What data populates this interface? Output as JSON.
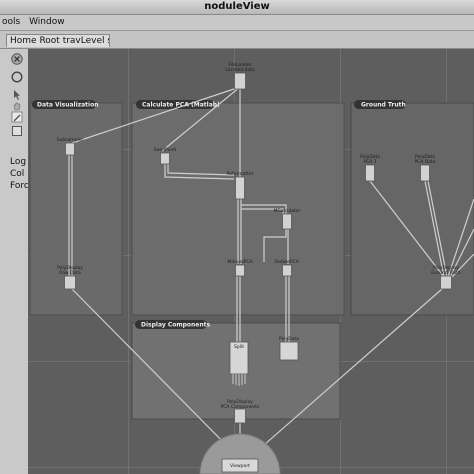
{
  "window": {
    "title": "noduleView"
  },
  "menubar": {
    "items": [
      "ools",
      "Window"
    ]
  },
  "breadcrumb": {
    "text": "Home Root travLevel shmStatus"
  },
  "left_panel": {
    "tools": [
      {
        "name": "close-tool",
        "icon": "x-circle-icon"
      },
      {
        "name": "circle-tool",
        "icon": "circle-icon"
      },
      {
        "name": "pointer-tool",
        "icon": "pointer-icon"
      },
      {
        "name": "hand-tool",
        "icon": "hand-icon"
      },
      {
        "name": "edit-tool",
        "icon": "pencil-icon"
      },
      {
        "name": "select-tool",
        "icon": "square-icon"
      }
    ],
    "labels": {
      "log": "Log",
      "col": "Col",
      "force": "Force"
    }
  },
  "canvas": {
    "groups": {
      "data_visualization": "Data Visualization",
      "calculate_pca": "Calculate PCA (Matlab)",
      "ground_truth": "Ground Truth",
      "display_components": "Display Components"
    },
    "nodes": {
      "top_loader": "FileLoader\nLocated data",
      "subsampler": "Subsampler",
      "seedpoint": "SeedPoint",
      "reformatter": "Reformatter",
      "setcomputer": "MCalculator",
      "manual_pca": "ManualPCA",
      "rotate_pca": "RotatePCA",
      "left_display": "PolyDisplay\nRaw Data",
      "ground_1": "PolyData\nPCA 1",
      "ground_2": "PolyData\nPCA Data",
      "ground_display": "PolyDisplay\nGround Truth",
      "pcs_node": "Split",
      "pca_poly": "PolyData",
      "pca_components": "PolyDisplay\nPCA Components",
      "bottom_node": "Viewport"
    },
    "colors": {
      "background": "#5e5e5e",
      "group_fill": "#6e6e6e",
      "ground_truth_fill": "#666666",
      "group_label_bg": "#333333",
      "node_fill": "#d2d2d2",
      "edge": "#cfcfcf"
    }
  }
}
